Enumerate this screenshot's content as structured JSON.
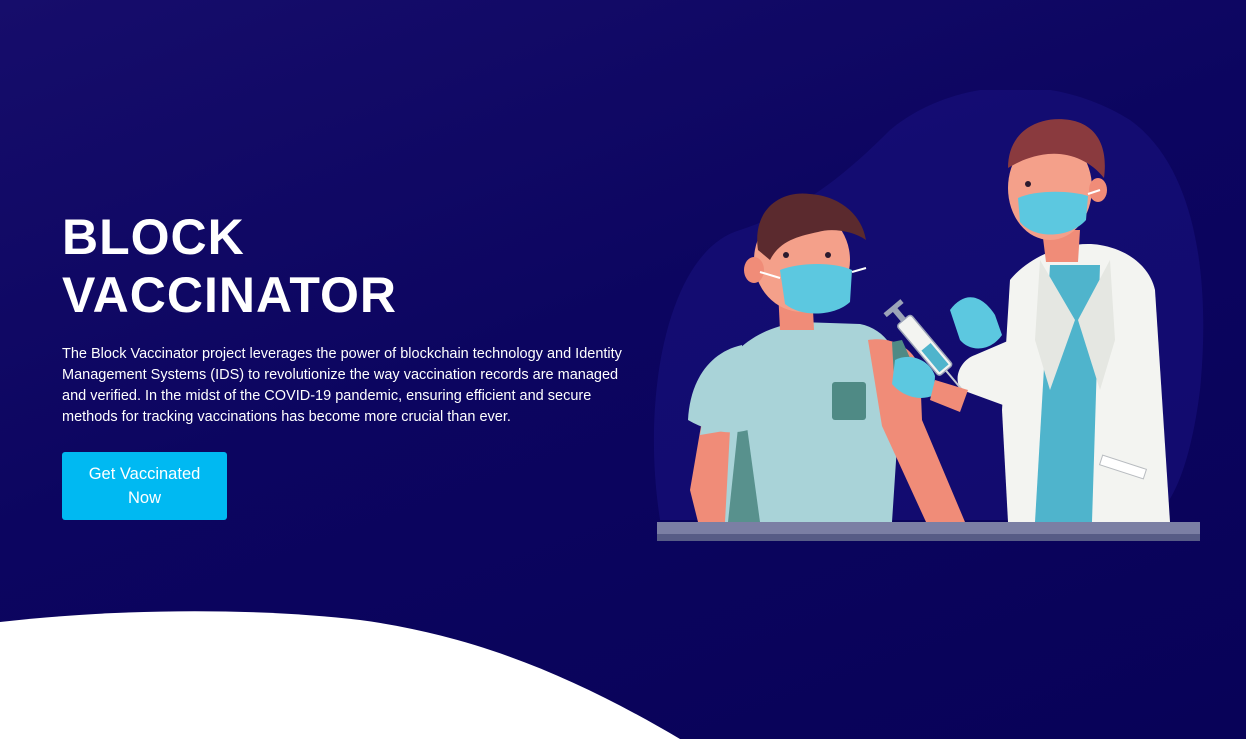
{
  "hero": {
    "title_line1": "BLOCK",
    "title_line2": "VACCINATOR",
    "description": "The Block Vaccinator project leverages the power of blockchain technology and Identity Management Systems (IDS) to revolutionize the way vaccination records are managed and verified. In the midst of the COVID-19 pandemic, ensuring efficient and secure methods for tracking vaccinations has become more crucial than ever.",
    "cta_label": "Get Vaccinated Now"
  },
  "colors": {
    "background": "#0c0560",
    "cta": "#00b9f2",
    "mask": "#5cc8e0",
    "text": "#ffffff"
  }
}
